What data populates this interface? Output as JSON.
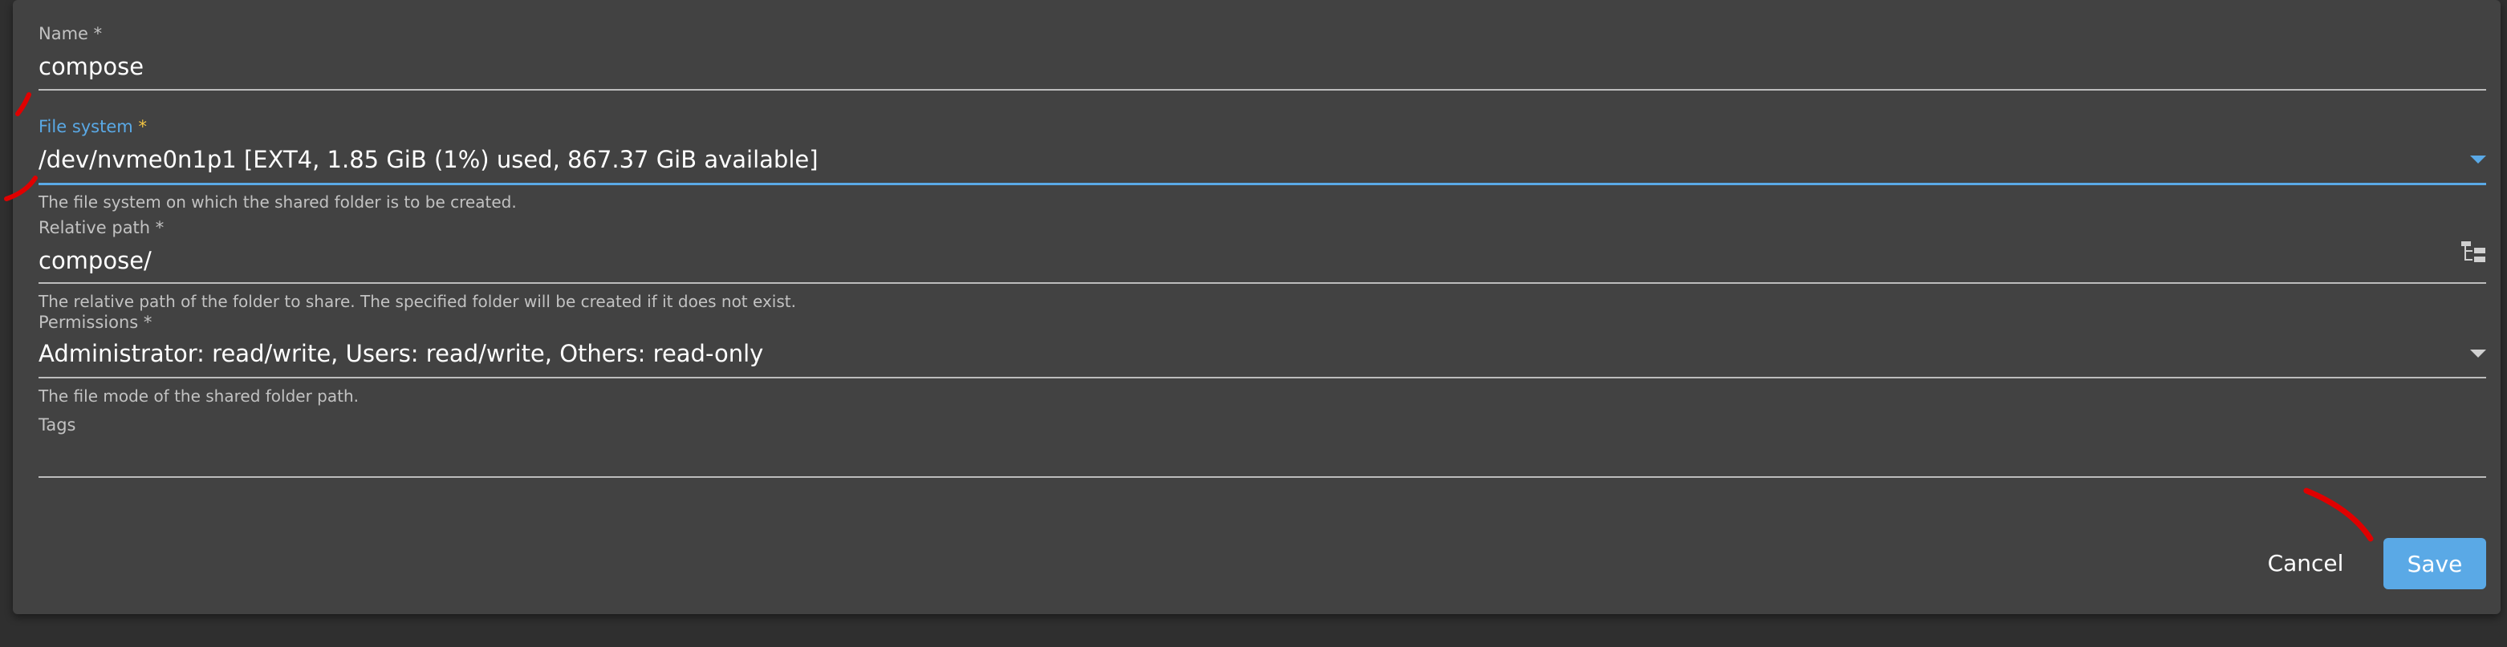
{
  "form": {
    "name": {
      "label": "Name",
      "required_mark": "*",
      "value": "compose"
    },
    "file_system": {
      "label": "File system",
      "required_mark": "*",
      "value": "/dev/nvme0n1p1 [EXT4, 1.85 GiB (1%) used, 867.37 GiB available]",
      "hint": "The file system on which the shared folder is to be created.",
      "icon": "chevron-down-icon"
    },
    "relative_path": {
      "label": "Relative path",
      "required_mark": "*",
      "value": "compose/",
      "hint": "The relative path of the folder to share. The specified folder will be created if it does not exist.",
      "icon": "folder-tree-icon"
    },
    "permissions": {
      "label": "Permissions",
      "required_mark": "*",
      "value": "Administrator: read/write, Users: read/write, Others: read-only",
      "hint": "The file mode of the shared folder path.",
      "icon": "chevron-down-icon"
    },
    "tags": {
      "label": "Tags",
      "value": ""
    }
  },
  "actions": {
    "cancel_label": "Cancel",
    "save_label": "Save"
  },
  "colors": {
    "background": "#2f2f2f",
    "card": "#424242",
    "accent": "#5aa9e6",
    "required_active": "#f4c542",
    "annotation": "#e00000"
  }
}
